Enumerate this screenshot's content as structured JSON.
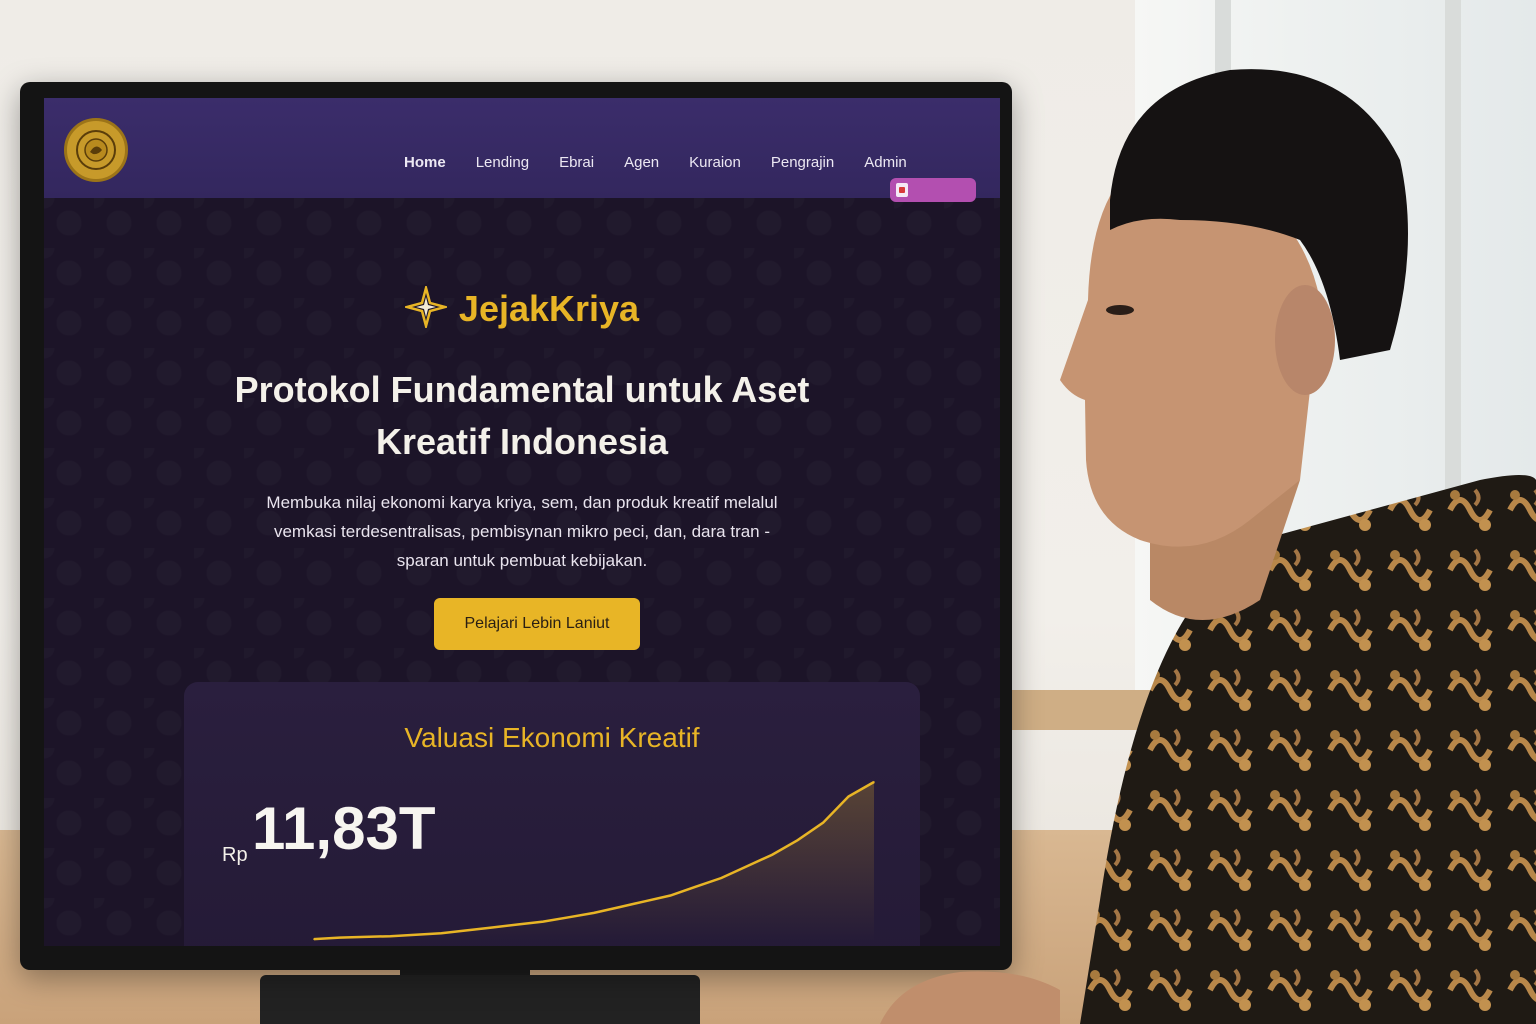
{
  "nav": {
    "items": [
      "Home",
      "Lending",
      "Ebrai",
      "Agen",
      "Kuraion",
      "Pengrajin",
      "Admin"
    ],
    "active": "Home",
    "wallet_text": ""
  },
  "hero": {
    "brand": "JejakKriya",
    "title_line1": "Protokol Fundamental untuk Aset",
    "title_line2": "Kreatif Indonesia",
    "subtitle_line1": "Membuka nilaj ekonomi karya kriya, sem, dan produk kreatif melalul",
    "subtitle_line2": "vemkasi terdesentralisas,  pembisynan mikro peci, dan, dara tran -",
    "subtitle_line3": "sparan untuk pembuat kebijakan.",
    "cta_label": "Pelajari Lebin Laniut"
  },
  "valuation": {
    "title": "Valuasi Ekonomi Kreatif",
    "currency": "Rp",
    "value": "11,83T"
  },
  "colors": {
    "accent": "#e8b526",
    "nav_bg": "#3b2d6b",
    "screen_bg": "#1c1428",
    "wallet_bg": "#b34fb0"
  },
  "chart_data": {
    "type": "area",
    "title": "Valuasi Ekonomi Kreatif",
    "xlabel": "",
    "ylabel": "",
    "grid": false,
    "y": [
      2,
      3,
      3.5,
      4,
      5,
      6,
      8,
      10,
      12,
      14,
      17,
      20,
      24,
      28,
      32,
      38,
      44,
      52,
      60,
      70,
      82,
      100,
      110
    ]
  }
}
